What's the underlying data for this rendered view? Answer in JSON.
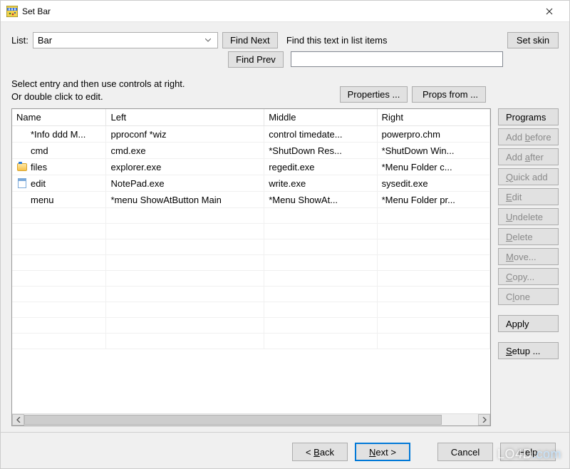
{
  "window": {
    "title": "Set Bar"
  },
  "list": {
    "label": "List:",
    "value": "Bar"
  },
  "find": {
    "next": "Find Next",
    "prev": "Find Prev",
    "label": "Find this text in list items",
    "value": ""
  },
  "setskin": "Set skin",
  "instructions_line1": "Select entry and then use controls at right.",
  "instructions_line2": "Or double click to edit.",
  "midbtn": {
    "properties": "Properties ...",
    "propsfrom": "Props from ..."
  },
  "columns": {
    "name": "Name",
    "left": "Left",
    "middle": "Middle",
    "right": "Right"
  },
  "rows": [
    {
      "icon": "none",
      "name": "*Info ddd M...",
      "left": "pproconf *wiz",
      "middle": "control timedate...",
      "right": "powerpro.chm"
    },
    {
      "icon": "none",
      "name": "cmd",
      "left": "cmd.exe",
      "middle": "*ShutDown Res...",
      "right": "*ShutDown Win..."
    },
    {
      "icon": "folder",
      "name": "files",
      "left": "explorer.exe",
      "middle": "regedit.exe",
      "right": "*Menu Folder c..."
    },
    {
      "icon": "notepad",
      "name": "edit",
      "left": "NotePad.exe",
      "middle": "write.exe",
      "right": "sysedit.exe"
    },
    {
      "icon": "none",
      "name": "menu",
      "left": "*menu ShowAtButton Main",
      "middle": "*Menu ShowAt...",
      "right": "*Menu Folder pr..."
    }
  ],
  "blank_rows": 9,
  "sidebar": {
    "programs": "Programs",
    "addbefore": "Add before",
    "addafter": "Add after",
    "quickadd": "Quick add",
    "edit": "Edit",
    "undelete": "Undelete",
    "delete": "Delete",
    "move": "Move...",
    "copy": "Copy...",
    "clone": "Clone",
    "apply": "Apply",
    "setup": "Setup ..."
  },
  "footer": {
    "back": "< Back",
    "next": "Next >",
    "cancel": "Cancel",
    "help": "Help"
  },
  "watermark": "LO4D",
  "watermark_suffix": ".com"
}
